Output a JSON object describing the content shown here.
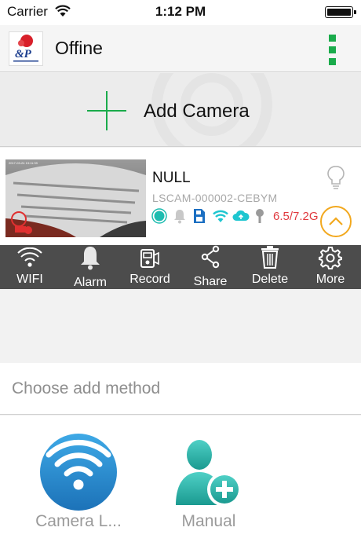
{
  "status_bar": {
    "carrier": "Carrier",
    "time": "1:12 PM"
  },
  "header": {
    "title": "Offine",
    "menu_icon": "more-vertical-icon",
    "accent_color": "#1aab4b"
  },
  "add_camera": {
    "label": "Add Camera"
  },
  "camera": {
    "name": "NULL",
    "uid": "LSCAM-000002-CEBYM",
    "storage": "6.5/7.2G",
    "status_icons": [
      "online-dot-icon",
      "bell-icon",
      "sd-card-icon",
      "wifi-icon",
      "cloud-icon",
      "sensor-icon"
    ],
    "storage_color": "#e0393e"
  },
  "toolbar": {
    "items": [
      {
        "label": "WIFI",
        "icon": "wifi-icon"
      },
      {
        "label": "Alarm",
        "icon": "bell-icon"
      },
      {
        "label": "Record",
        "icon": "record-icon"
      },
      {
        "label": "Share",
        "icon": "share-icon"
      },
      {
        "label": "Delete",
        "icon": "trash-icon"
      },
      {
        "label": "More",
        "icon": "gear-icon"
      }
    ]
  },
  "add_method": {
    "title": "Choose add method",
    "options": [
      {
        "label": "Camera L...",
        "icon": "wifi-circle-icon"
      },
      {
        "label": "Manual",
        "icon": "add-user-icon"
      }
    ]
  }
}
